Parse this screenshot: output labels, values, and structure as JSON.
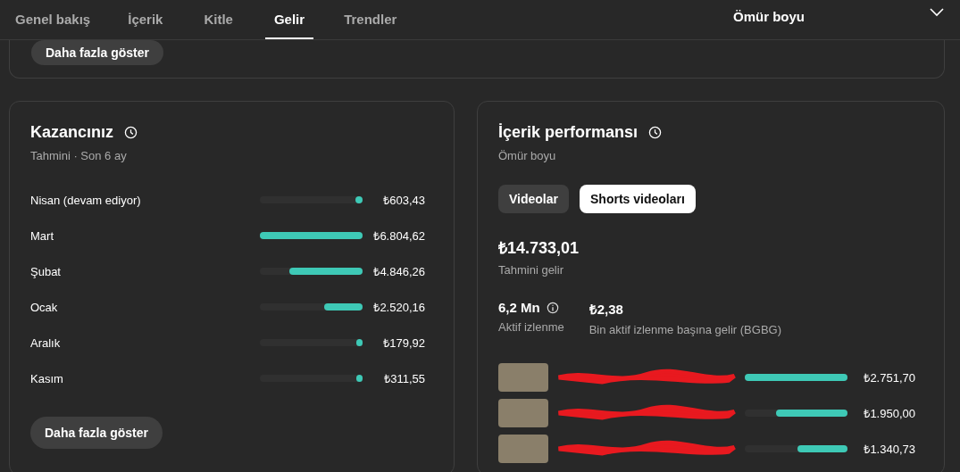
{
  "tabs": [
    {
      "label": "Genel bakış",
      "selected": false
    },
    {
      "label": "İçerik",
      "selected": false
    },
    {
      "label": "Kitle",
      "selected": false
    },
    {
      "label": "Gelir",
      "selected": true
    },
    {
      "label": "Trendler",
      "selected": false
    }
  ],
  "period": {
    "value": "Ömür boyu"
  },
  "top_card": {
    "button": "Daha fazla göster"
  },
  "earnings": {
    "title": "Kazancınız",
    "subtitle": "Tahmini · Son 6 ay",
    "months": [
      {
        "name": "Nisan (devam ediyor)",
        "level": 0.07,
        "amount": "₺603,43"
      },
      {
        "name": "Mart",
        "level": 1,
        "amount": "₺6.804,62"
      },
      {
        "name": "Şubat",
        "level": 0.71,
        "amount": "₺4.846,26"
      },
      {
        "name": "Ocak",
        "level": 0.37,
        "amount": "₺2.520,16"
      },
      {
        "name": "Aralık",
        "level": 0.06,
        "amount": "₺179,92"
      },
      {
        "name": "Kasım",
        "level": 0.06,
        "amount": "₺311,55"
      }
    ],
    "button": "Daha fazla göster"
  },
  "performance": {
    "title": "İçerik performansı",
    "subtitle": "Ömür boyu",
    "chips": [
      {
        "label": "Videolar",
        "selected": false
      },
      {
        "label": "Shorts videoları",
        "selected": true
      }
    ],
    "total": "₺14.733,01",
    "total_label": "Tahmini gelir",
    "stats": [
      {
        "value": "6,2 Mn",
        "label": "Aktif izlenme",
        "info": true
      },
      {
        "value": "₺2,38",
        "label": "Bin aktif izlenme başına gelir (BGBG)",
        "info": false
      }
    ],
    "videos": [
      {
        "level": 1,
        "amount": "₺2.751,70"
      },
      {
        "level": 0.7,
        "amount": "₺1.950,00"
      },
      {
        "level": 0.49,
        "amount": "₺1.340,73"
      }
    ]
  }
}
